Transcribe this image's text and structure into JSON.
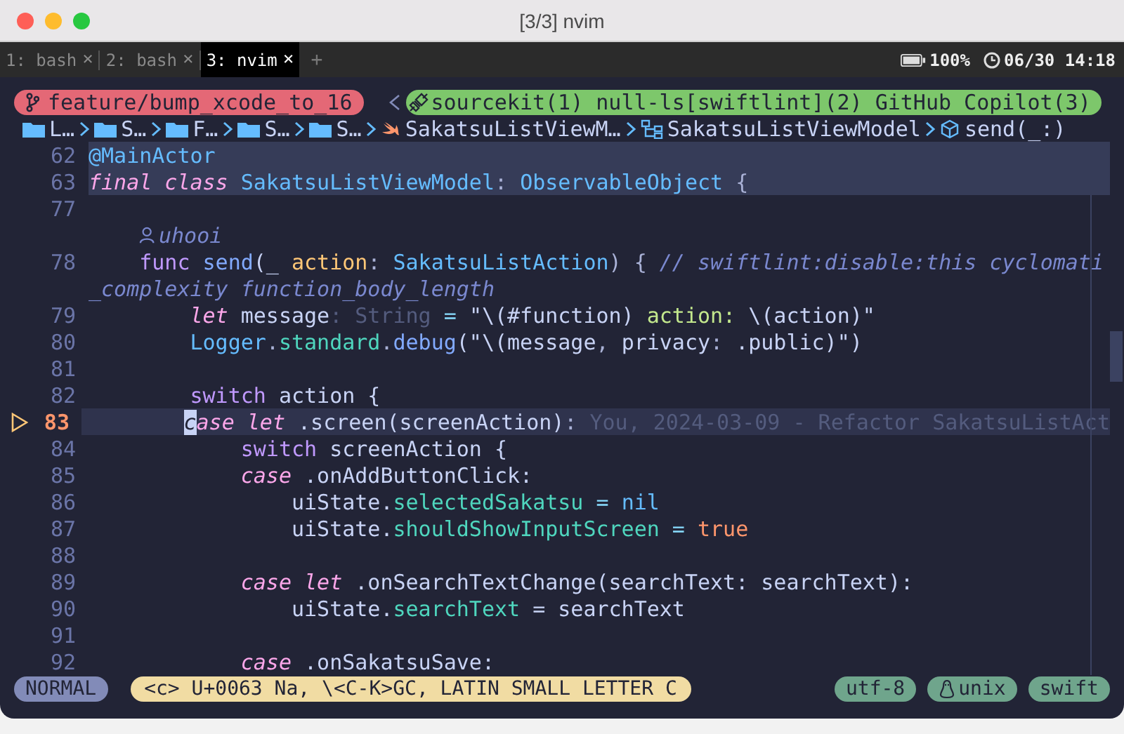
{
  "window": {
    "title": "[3/3] nvim"
  },
  "tabs": [
    {
      "label": "1: bash",
      "close": "×",
      "selected": false
    },
    {
      "label": "2: bash",
      "close": "×",
      "selected": false
    },
    {
      "label": "3: nvim",
      "close": "×",
      "selected": true
    }
  ],
  "new_tab": "+",
  "status_right": {
    "battery": "100%",
    "clock": "06/30 14:18"
  },
  "winbar": {
    "branch": "feature/bump_xcode_to_16",
    "lsp": "sourcekit(1) null-ls[swiftlint](2) GitHub Copilot(3)"
  },
  "breadcrumbs": [
    {
      "kind": "folder",
      "label": "L…"
    },
    {
      "kind": "folder",
      "label": "S…"
    },
    {
      "kind": "folder",
      "label": "F…"
    },
    {
      "kind": "folder",
      "label": "S…"
    },
    {
      "kind": "folder",
      "label": "S…"
    },
    {
      "kind": "swift",
      "label": "SakatsuListViewM…"
    },
    {
      "kind": "class",
      "label": "SakatsuListViewModel"
    },
    {
      "kind": "method",
      "label": "send(_:)"
    }
  ],
  "code": [
    {
      "kind": "code",
      "number": "62",
      "sticky": true,
      "current": false,
      "tokens": [
        {
          "t": "@MainActor",
          "kind": "type"
        }
      ]
    },
    {
      "kind": "code",
      "number": "63",
      "sticky": true,
      "current": false,
      "tokens": [
        {
          "t": "final class",
          "kind": "kwi"
        },
        {
          "t": " SakatsuListViewModel",
          "kind": "type"
        },
        {
          "t": ": ",
          "kind": "punct"
        },
        {
          "t": "ObservableObject",
          "kind": "type"
        },
        {
          "t": " {",
          "kind": "punct"
        }
      ]
    },
    {
      "kind": "code",
      "number": "77",
      "sticky": false,
      "current": false
    },
    {
      "kind": "lens",
      "text": "uhooi"
    },
    {
      "kind": "code",
      "number": "78",
      "sticky": false,
      "current": false,
      "tokens": [
        {
          "t": "    func",
          "kind": "kw"
        },
        {
          "t": " send",
          "kind": "fn"
        },
        {
          "t": "(_ ",
          "kind": "text"
        },
        {
          "t": "action",
          "kind": "param"
        },
        {
          "t": ": ",
          "kind": "punct"
        },
        {
          "t": "SakatsuListAction",
          "kind": "type"
        },
        {
          "t": ") { ",
          "kind": "punct"
        },
        {
          "t": "// swiftlint:disable:this cyclomati",
          "kind": "comment"
        }
      ]
    },
    {
      "kind": "wrap",
      "tokens": [
        {
          "t": "_complexity function_body_length",
          "kind": "comment"
        }
      ]
    },
    {
      "kind": "code",
      "number": "79",
      "sticky": false,
      "current": false,
      "tokens": [
        {
          "t": "        let",
          "kind": "kwi"
        },
        {
          "t": " message",
          "kind": "text"
        },
        {
          "t": ": String",
          "kind": "hint"
        },
        {
          "t": " = ",
          "kind": "op"
        },
        {
          "t": "\"\\(#function) ",
          "kind": "text"
        },
        {
          "t": "action: ",
          "kind": "string"
        },
        {
          "t": "\\(action)\"",
          "kind": "text"
        }
      ]
    },
    {
      "kind": "code",
      "number": "80",
      "sticky": false,
      "current": false,
      "tokens": [
        {
          "t": "        Logger",
          "kind": "type"
        },
        {
          "t": ".",
          "kind": "punct"
        },
        {
          "t": "standard",
          "kind": "member"
        },
        {
          "t": ".",
          "kind": "punct"
        },
        {
          "t": "debug",
          "kind": "fn"
        },
        {
          "t": "(\"\\(message",
          "kind": "text"
        },
        {
          "t": ", ",
          "kind": "punct"
        },
        {
          "t": "privacy",
          "kind": "text"
        },
        {
          "t": ": ",
          "kind": "punct"
        },
        {
          "t": ".public)\")",
          "kind": "text"
        }
      ]
    },
    {
      "kind": "code",
      "number": "81",
      "sticky": false,
      "current": false
    },
    {
      "kind": "code",
      "number": "82",
      "sticky": false,
      "current": false,
      "tokens": [
        {
          "t": "        switch",
          "kind": "kw"
        },
        {
          "t": " action {",
          "kind": "text"
        }
      ]
    },
    {
      "kind": "code",
      "number": "83",
      "sticky": false,
      "current": true,
      "tokens": [
        {
          "t": "        case let",
          "kind": "kwi"
        },
        {
          "t": " .screen(screenAction)",
          "kind": "text"
        },
        {
          "t": ":",
          "kind": "punct"
        }
      ],
      "blame": " You, 2024-03-09 - Refactor SakatsuListAct"
    },
    {
      "kind": "code",
      "number": "84",
      "sticky": false,
      "current": false,
      "tokens": [
        {
          "t": "            switch",
          "kind": "kw"
        },
        {
          "t": " screenAction {",
          "kind": "text"
        }
      ]
    },
    {
      "kind": "code",
      "number": "85",
      "sticky": false,
      "current": false,
      "tokens": [
        {
          "t": "            case",
          "kind": "kwi"
        },
        {
          "t": " .onAddButtonClick:",
          "kind": "text"
        }
      ]
    },
    {
      "kind": "code",
      "number": "86",
      "sticky": false,
      "current": false,
      "tokens": [
        {
          "t": "                uiState.",
          "kind": "text"
        },
        {
          "t": "selectedSakatsu",
          "kind": "member"
        },
        {
          "t": " = ",
          "kind": "op"
        },
        {
          "t": "nil",
          "kind": "type"
        }
      ]
    },
    {
      "kind": "code",
      "number": "87",
      "sticky": false,
      "current": false,
      "tokens": [
        {
          "t": "                uiState.",
          "kind": "text"
        },
        {
          "t": "shouldShowInputScreen",
          "kind": "member"
        },
        {
          "t": " = ",
          "kind": "op"
        },
        {
          "t": "true",
          "kind": "const"
        }
      ]
    },
    {
      "kind": "code",
      "number": "88",
      "sticky": false,
      "current": false
    },
    {
      "kind": "code",
      "number": "89",
      "sticky": false,
      "current": false,
      "tokens": [
        {
          "t": "            case let",
          "kind": "kwi"
        },
        {
          "t": " .onSearchTextChange(searchText: searchText):",
          "kind": "text"
        }
      ]
    },
    {
      "kind": "code",
      "number": "90",
      "sticky": false,
      "current": false,
      "tokens": [
        {
          "t": "                uiState.",
          "kind": "text"
        },
        {
          "t": "searchText",
          "kind": "member"
        },
        {
          "t": " = searchText",
          "kind": "text"
        }
      ]
    },
    {
      "kind": "code",
      "number": "91",
      "sticky": false,
      "current": false
    },
    {
      "kind": "code",
      "number": "92",
      "sticky": false,
      "current": false,
      "tokens": [
        {
          "t": "            case",
          "kind": "kwi"
        },
        {
          "t": " .onSakatsuSave:",
          "kind": "text"
        }
      ]
    }
  ],
  "statusline": {
    "mode": "NORMAL",
    "char_info": "<c> U+0063 Na, \\<C-K>GC, LATIN SMALL LETTER C",
    "encoding": "utf-8",
    "format": "unix",
    "filetype": "swift"
  }
}
